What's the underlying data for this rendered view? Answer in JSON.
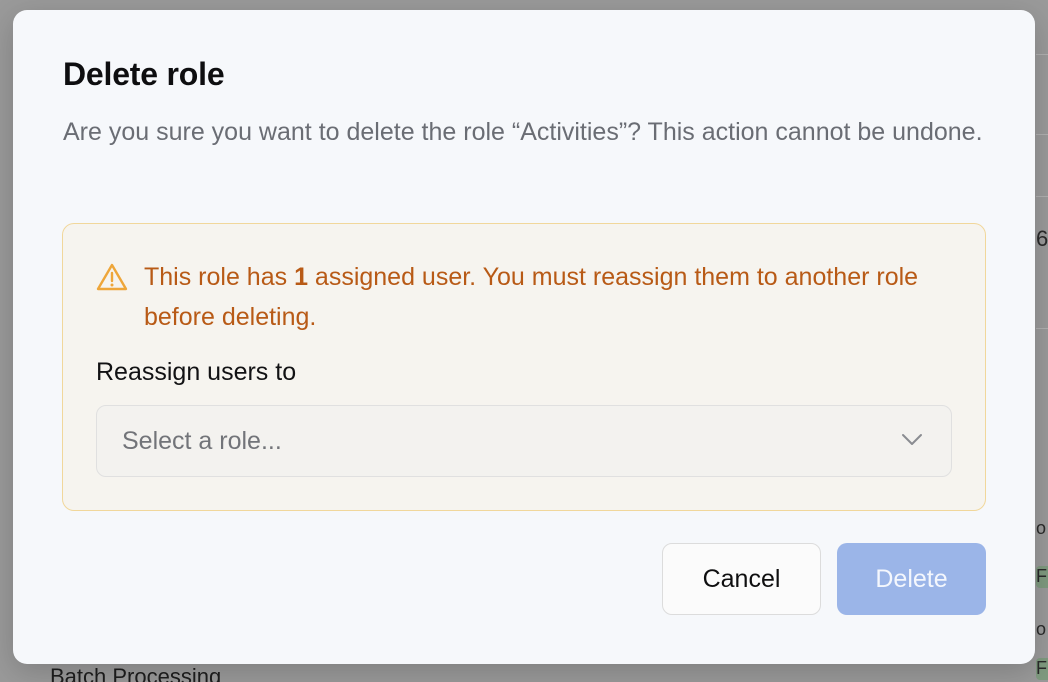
{
  "background": {
    "right_edge_glyph": "6",
    "row_label": "Batch Processing",
    "right_edge_fragments": [
      "o",
      "F",
      "o",
      "F"
    ]
  },
  "modal": {
    "title": "Delete role",
    "description": "Are you sure you want to delete the role “Activities”? This action cannot be undone.",
    "warning": {
      "icon": "warning-triangle-icon",
      "text_prefix": "This role has ",
      "count": "1",
      "text_suffix": " assigned user. You must reassign them to another role before deleting.",
      "color": "#b85a16"
    },
    "reassign": {
      "label": "Reassign users to",
      "placeholder": "Select a role...",
      "selected_value": ""
    },
    "actions": {
      "cancel_label": "Cancel",
      "delete_label": "Delete",
      "delete_disabled": true
    }
  },
  "colors": {
    "primary_disabled": "#9bb5e8",
    "warning_border": "#f1d79b",
    "warning_bg": "#f6f4ef"
  }
}
